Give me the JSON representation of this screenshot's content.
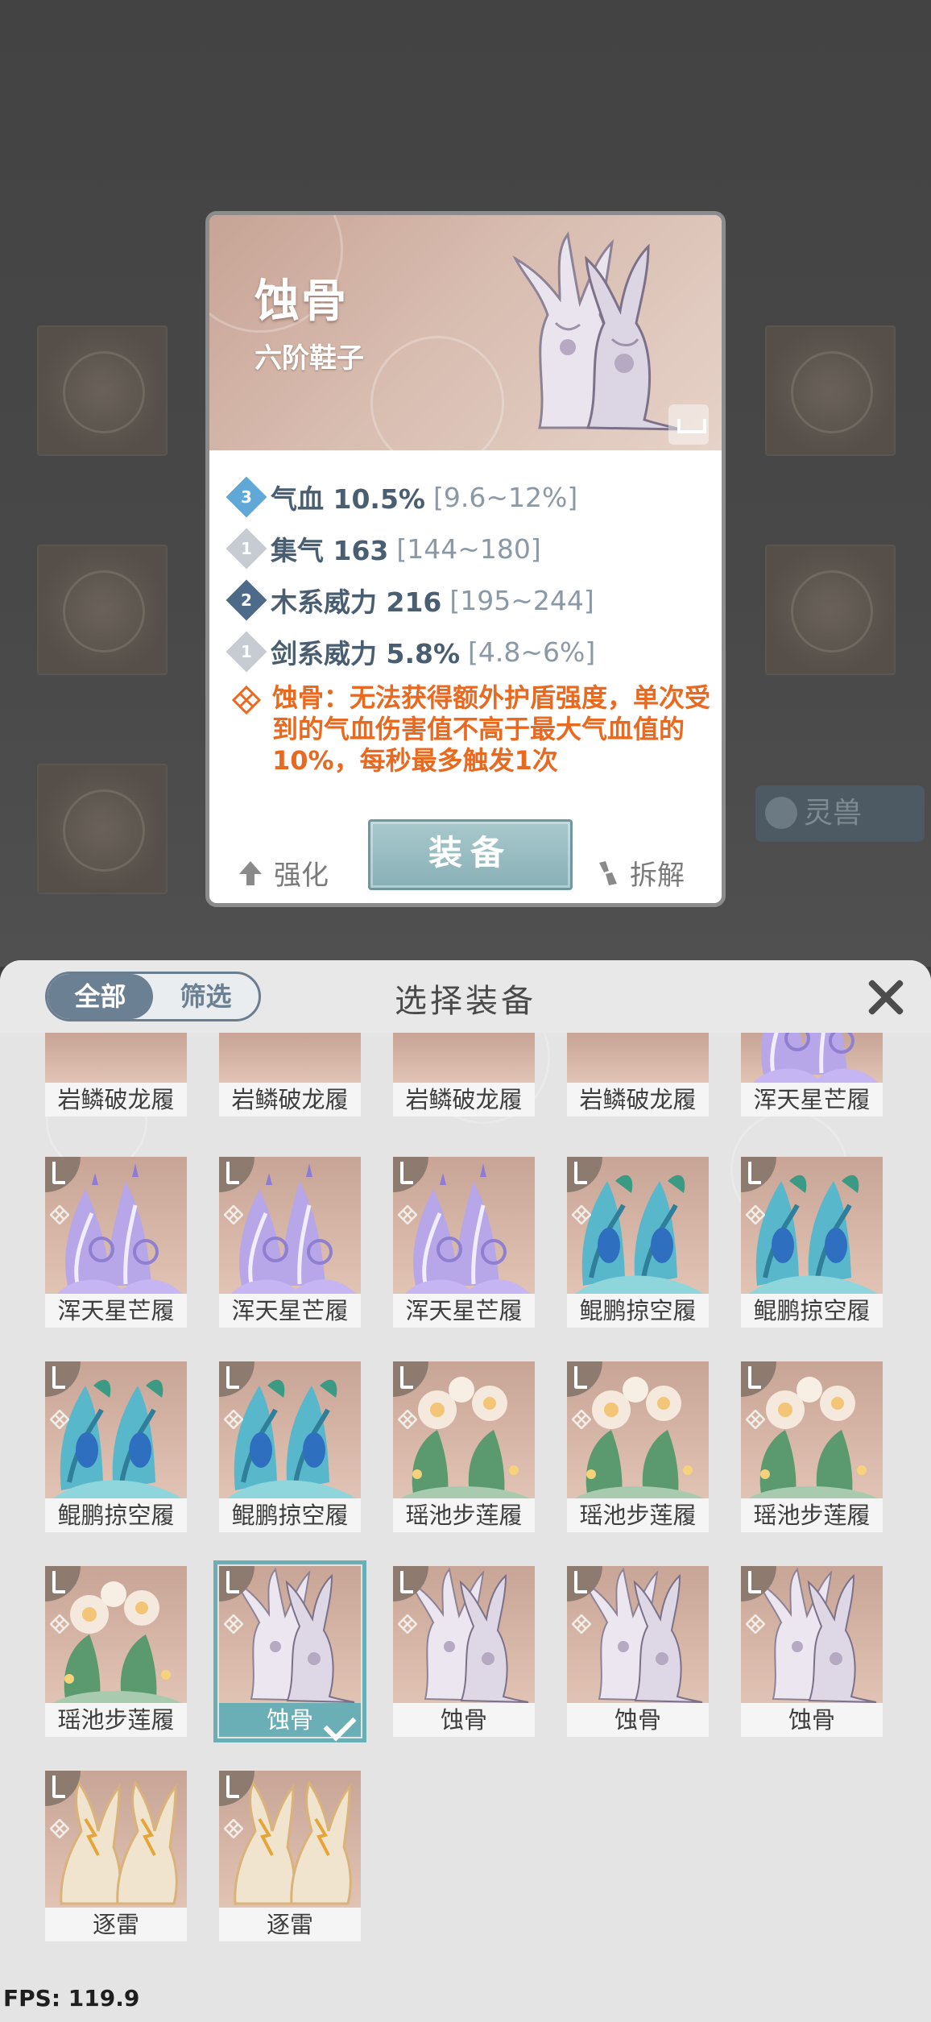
{
  "detail": {
    "name": "蚀骨",
    "subtitle": "六阶鞋子",
    "stats": [
      {
        "rank": "3",
        "text": "气血 10.5%",
        "range": "[9.6~12%]",
        "color": "#5fa8d8"
      },
      {
        "rank": "1",
        "text": "集气 163",
        "range": "[144~180]",
        "color": "#c7ccd2"
      },
      {
        "rank": "2",
        "text": "木系威力 216",
        "range": "[195~244]",
        "color": "#4d6a88"
      },
      {
        "rank": "1",
        "text": "剑系威力 5.8%",
        "range": "[4.8~6%]",
        "color": "#c7ccd2"
      }
    ],
    "effect": "蚀骨：无法获得额外护盾强度，单次受到的气血伤害值不高于最大气血值的10%，每秒最多触发1次",
    "enhance_label": "强化",
    "equip_label": "装备",
    "dismantle_label": "拆解"
  },
  "background": {
    "spirit_beast_label": "灵兽"
  },
  "panel": {
    "tab_all": "全部",
    "tab_filter": "筛选",
    "title": "选择装备"
  },
  "items": [
    {
      "name": "岩鳞破龙履",
      "art": "dragon",
      "corner": false
    },
    {
      "name": "岩鳞破龙履",
      "art": "dragon",
      "corner": false
    },
    {
      "name": "岩鳞破龙履",
      "art": "dragon",
      "corner": false
    },
    {
      "name": "岩鳞破龙履",
      "art": "dragon",
      "corner": false
    },
    {
      "name": "浑天星芒履",
      "art": "star",
      "corner": false
    },
    {
      "name": "浑天星芒履",
      "art": "star",
      "corner": true
    },
    {
      "name": "浑天星芒履",
      "art": "star",
      "corner": true
    },
    {
      "name": "浑天星芒履",
      "art": "star",
      "corner": true
    },
    {
      "name": "鲲鹏掠空履",
      "art": "kun",
      "corner": true
    },
    {
      "name": "鲲鹏掠空履",
      "art": "kun",
      "corner": true
    },
    {
      "name": "鲲鹏掠空履",
      "art": "kun",
      "corner": true
    },
    {
      "name": "鲲鹏掠空履",
      "art": "kun",
      "corner": true
    },
    {
      "name": "瑶池步莲履",
      "art": "lotus",
      "corner": true
    },
    {
      "name": "瑶池步莲履",
      "art": "lotus",
      "corner": true
    },
    {
      "name": "瑶池步莲履",
      "art": "lotus",
      "corner": true
    },
    {
      "name": "瑶池步莲履",
      "art": "lotus",
      "corner": true
    },
    {
      "name": "蚀骨",
      "art": "bone",
      "corner": true,
      "selected": true
    },
    {
      "name": "蚀骨",
      "art": "bone",
      "corner": true
    },
    {
      "name": "蚀骨",
      "art": "bone",
      "corner": true
    },
    {
      "name": "蚀骨",
      "art": "bone",
      "corner": true
    },
    {
      "name": "逐雷",
      "art": "thunder",
      "corner": true
    },
    {
      "name": "逐雷",
      "art": "thunder",
      "corner": true
    }
  ],
  "fps": "FPS: 119.9"
}
